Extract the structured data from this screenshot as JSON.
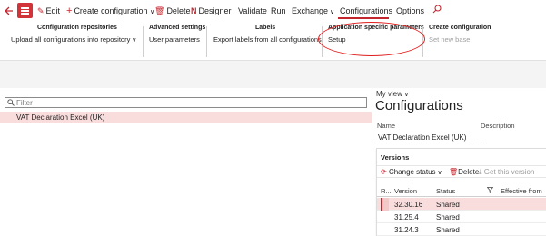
{
  "topbar": {
    "edit": "Edit",
    "create_configuration": "Create configuration",
    "delete": "Delete",
    "designer": "Designer",
    "validate": "Validate",
    "run": "Run",
    "exchange": "Exchange",
    "configurations_tab": "Configurations",
    "options_tab": "Options"
  },
  "ribbon": {
    "groups": [
      {
        "title": "Configuration repositories",
        "item": "Upload all configurations into repository"
      },
      {
        "title": "Advanced settings",
        "item": "User parameters"
      },
      {
        "title": "Labels",
        "item": "Export labels from all configurations"
      },
      {
        "title": "Application specific parameters",
        "item": "Setup"
      },
      {
        "title": "Create configuration",
        "item": "Set new base"
      }
    ]
  },
  "left_pane": {
    "filter_placeholder": "Filter",
    "rows": [
      "VAT Declaration Excel (UK)"
    ]
  },
  "right_pane": {
    "my_view": "My view",
    "title": "Configurations",
    "name_label": "Name",
    "description_label": "Description",
    "name_value": "VAT Declaration Excel (UK)",
    "versions": {
      "title": "Versions",
      "change_status": "Change status",
      "delete": "Delete",
      "get_this_version": "Get this version",
      "columns": [
        "R...",
        "Version",
        "Status",
        "Effective from"
      ],
      "rows": [
        {
          "version": "32.30.16",
          "status": "Shared"
        },
        {
          "version": "31.25.4",
          "status": "Shared"
        },
        {
          "version": "31.24.3",
          "status": "Shared"
        }
      ]
    }
  },
  "colors": {
    "accent": "#c4262e",
    "selection": "#f9dcdc",
    "annotation": "#e01e1e"
  }
}
